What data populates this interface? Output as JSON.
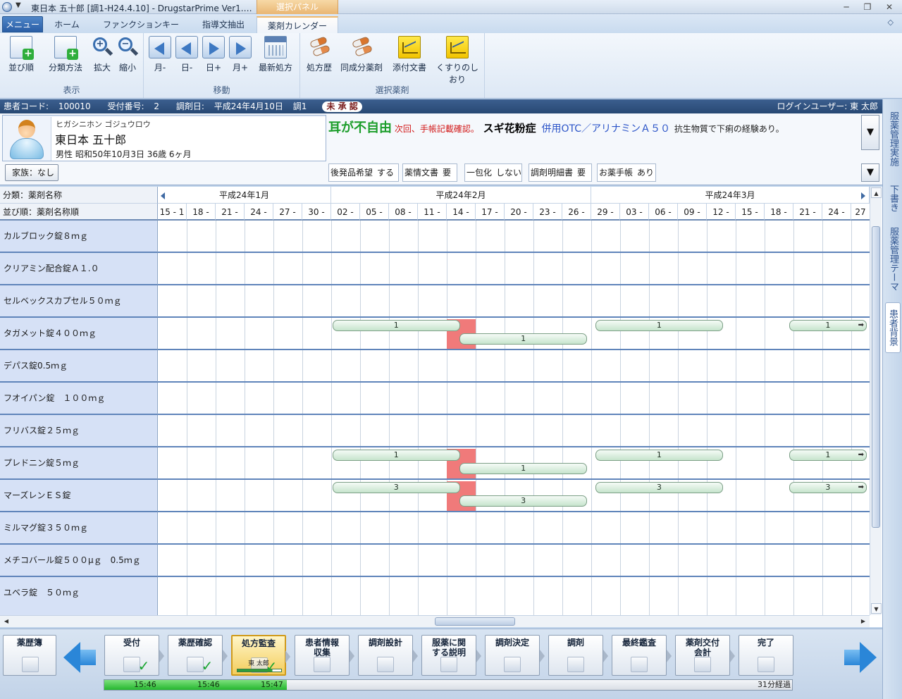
{
  "window": {
    "quick_access": "▼",
    "title": "東日本 五十郎 [調1-H24.4.10] - DrugstarPrime Ver1.…",
    "context_tab": "選択パネル",
    "minimize": "─",
    "restore": "❐",
    "close": "✕"
  },
  "tabs": {
    "menu": "メニュー",
    "items": [
      "ホーム",
      "ファンクションキー",
      "指導文抽出",
      "薬剤カレンダー"
    ],
    "active": "薬剤カレンダー",
    "help": "◇"
  },
  "ribbon": {
    "groups": [
      {
        "label": "表示",
        "buttons": [
          "並び順",
          "分類方法",
          "拡大",
          "縮小"
        ]
      },
      {
        "label": "移動",
        "buttons": [
          "月-",
          "日-",
          "日+",
          "月+",
          "最新処方"
        ]
      },
      {
        "label": "選択薬剤",
        "buttons": [
          "処方歴",
          "同成分薬剤",
          "添付文書",
          "くすりのしおり"
        ]
      }
    ],
    "zoom_in_glyph": "+",
    "zoom_out_glyph": "−"
  },
  "patient": {
    "code_label": "患者コード:",
    "code": "100010",
    "reception_label": "受付番号:",
    "reception": "2",
    "date_label": "調剤日:",
    "date": "平成24年4月10日",
    "dispense": "調1",
    "status": "未 承 認",
    "login_label": "ログインユーザー:",
    "login_user": "東 太郎",
    "kana": "ヒガシニホン ゴジュウロウ",
    "name": "東日本 五十郎",
    "detail": "男性  昭和50年10月3日  36歳 6ヶ月",
    "family": "家族：なし",
    "note": {
      "p1": "耳が不自由",
      "p2": "次回、手帳記載確認。",
      "p3": "スギ花粉症",
      "p4": "併用OTC／アリナミンＡ５０",
      "p5": "抗生物質で下痢の経験あり。"
    },
    "dropdown": "▼",
    "flags": [
      {
        "label": "後発品希望",
        "value": "する"
      },
      {
        "label": "薬情文書",
        "value": "要"
      },
      {
        "label": "一包化",
        "value": "しない"
      },
      {
        "label": "調剤明細書",
        "value": "要"
      },
      {
        "label": "お薬手帳",
        "value": "あり"
      }
    ]
  },
  "side_tabs": [
    "服薬管理実施",
    "下書き",
    "服薬管理テーマ",
    "患者背景"
  ],
  "side_active": "患者背景",
  "calendar": {
    "header_category": "分類：薬剤名称",
    "header_sort": "並び順：薬剤名称順",
    "months": [
      "平成24年1月",
      "平成24年2月",
      "平成24年3月"
    ],
    "month_spans": [
      [
        0,
        6
      ],
      [
        6,
        15
      ],
      [
        15,
        25
      ]
    ],
    "dates": [
      "15 - 1",
      "18 -",
      "21 -",
      "24 -",
      "27 -",
      "30 -",
      "02 -",
      "05 -",
      "08 -",
      "11 -",
      "14 -",
      "17 -",
      "20 -",
      "23 -",
      "26 -",
      "29 -",
      "03 -",
      "06 -",
      "09 -",
      "12 -",
      "15 -",
      "18 -",
      "21 -",
      "24 -",
      "27"
    ],
    "drugs": [
      "カルブロック錠８ｍｇ",
      "クリアミン配合錠Ａ１.０",
      "セルベックスカプセル５０ｍｇ",
      "タガメット錠４００ｍｇ",
      "デパス錠0.5ｍｇ",
      "フオイパン錠　１００ｍｇ",
      "フリバス錠２５ｍｇ",
      "プレドニン錠５ｍｇ",
      "マーズレンＥＳ錠",
      "ミルマグ錠３５０ｍｇ",
      "メチコバール錠５００μｇ　0.5ｍｇ",
      "ユベラ錠　５０ｍｇ"
    ],
    "bars": [
      {
        "row": 3,
        "start": 6,
        "end": 10.5,
        "lane": 0,
        "label": "1",
        "more": false
      },
      {
        "row": 3,
        "start": 10.4,
        "end": 14.9,
        "lane": 1,
        "label": "1",
        "more": false
      },
      {
        "row": 3,
        "start": 15.1,
        "end": 19.6,
        "lane": 0,
        "label": "1",
        "more": false
      },
      {
        "row": 3,
        "start": 21.8,
        "end": 25,
        "lane": 0,
        "label": "1",
        "more": true
      },
      {
        "row": 7,
        "start": 6,
        "end": 10.5,
        "lane": 0,
        "label": "1",
        "more": false
      },
      {
        "row": 7,
        "start": 10.4,
        "end": 14.9,
        "lane": 1,
        "label": "1",
        "more": false
      },
      {
        "row": 7,
        "start": 15.1,
        "end": 19.6,
        "lane": 0,
        "label": "1",
        "more": false
      },
      {
        "row": 7,
        "start": 21.8,
        "end": 25,
        "lane": 0,
        "label": "1",
        "more": true
      },
      {
        "row": 8,
        "start": 6,
        "end": 10.5,
        "lane": 0,
        "label": "3",
        "more": false
      },
      {
        "row": 8,
        "start": 10.4,
        "end": 14.9,
        "lane": 1,
        "label": "3",
        "more": false
      },
      {
        "row": 8,
        "start": 15.1,
        "end": 19.6,
        "lane": 0,
        "label": "3",
        "more": false
      },
      {
        "row": 8,
        "start": 21.8,
        "end": 25,
        "lane": 0,
        "label": "3",
        "more": true
      }
    ],
    "highlight": {
      "col": 10,
      "rows": [
        3,
        7,
        8
      ]
    },
    "more_glyph": "➡",
    "scroll_up": "▲",
    "scroll_down": "▼",
    "scroll_left": "◀",
    "scroll_right": "▶"
  },
  "workflow": {
    "history": "薬歴簿",
    "steps": [
      {
        "label": "受付",
        "done": true
      },
      {
        "label": "薬歴確認",
        "done": true
      },
      {
        "label": "処方監査",
        "done": true,
        "active": true,
        "user": "東 太郎"
      },
      {
        "label": "患者情報\n収集",
        "done": false
      },
      {
        "label": "調剤設計",
        "done": false
      },
      {
        "label": "服薬に関\nする説明",
        "done": false
      },
      {
        "label": "調剤決定",
        "done": false
      },
      {
        "label": "調剤",
        "done": false
      },
      {
        "label": "最終鑑査",
        "done": false
      },
      {
        "label": "薬剤交付\n会計",
        "done": false
      },
      {
        "label": "完了",
        "done": false
      }
    ],
    "check": "✓",
    "times": [
      "15:46",
      "15:46",
      "15:47"
    ],
    "progress": 0.265,
    "elapsed": "31分経過"
  },
  "colors": {
    "accent": "#2a5ea6",
    "bar_green": "#c6e4cc",
    "highlight_red": "#f07a7a",
    "note_green": "#1b9d2a",
    "note_red": "#d21a1a",
    "note_blue": "#2b54c8"
  },
  "icons": [
    "app-icon",
    "add-doc-icon",
    "zoom-in-icon",
    "zoom-out-icon",
    "nav-prev-month-icon",
    "nav-prev-day-icon",
    "nav-next-day-icon",
    "nav-next-month-icon",
    "calendar-icon",
    "pill-icon",
    "note-icon",
    "avatar-icon",
    "back-arrow-icon",
    "forward-arrow-icon",
    "check-icon"
  ]
}
